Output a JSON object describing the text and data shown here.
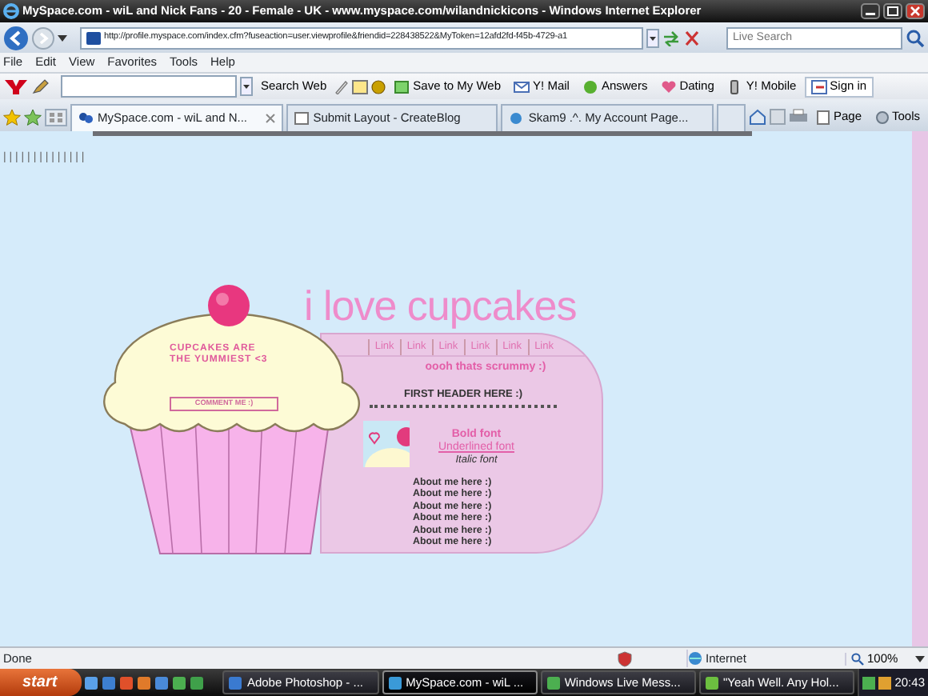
{
  "window": {
    "title": "MySpace.com - wiL and Nick Fans - 20 - Female - UK - www.myspace.com/wilandnickicons - Windows Internet Explorer"
  },
  "address_bar": {
    "url": "http://profile.myspace.com/index.cfm?fuseaction=user.viewprofile&friendid=228438522&MyToken=12afd2fd-f45b-4729-a1",
    "search_placeholder": "Live Search"
  },
  "menu": [
    "File",
    "Edit",
    "View",
    "Favorites",
    "Tools",
    "Help"
  ],
  "yahoo_toolbar": {
    "search_button": "Search Web",
    "items": [
      {
        "kind": "web",
        "label": "Save to My Web"
      },
      {
        "kind": "mail",
        "label": "Y! Mail"
      },
      {
        "kind": "answers",
        "label": "Answers"
      },
      {
        "kind": "dating",
        "label": "Dating"
      },
      {
        "kind": "mobile",
        "label": "Y! Mobile"
      },
      {
        "kind": "signin",
        "label": "Sign in"
      }
    ]
  },
  "tabs": [
    {
      "label": "MySpace.com - wiL and N...",
      "selected": true
    },
    {
      "label": "Submit Layout - CreateBlog",
      "selected": false
    },
    {
      "label": "Skam9 .^. My Account Page...",
      "selected": false
    }
  ],
  "command_bar": [
    "Page",
    "Tools"
  ],
  "page": {
    "ticks": "| | | | | | | | | | | | | |",
    "cupcake": {
      "tagline": [
        "CUPCAKES ARE",
        "THE YUMMIEST <3"
      ],
      "button": "COMMENT ME :)"
    },
    "title": "i love cupcakes",
    "links": [
      "Link",
      "Link",
      "Link",
      "Link",
      "Link",
      "Link"
    ],
    "subtitle": "oooh thats scrummy :)",
    "header": "FIRST HEADER HERE :)",
    "font_samples": [
      {
        "kind": "bold",
        "text": "Bold font"
      },
      {
        "kind": "underline",
        "text": "Underlined font"
      },
      {
        "kind": "italic",
        "text": "Italic font"
      }
    ],
    "about": [
      "About me here :)",
      "About me here :)",
      "About me here :)",
      "About me here :)",
      "About me here :)",
      "About me here :)"
    ]
  },
  "status_bar": {
    "text": "Done",
    "zone": "Internet",
    "zoom": "100%"
  },
  "taskbar": {
    "start": "start",
    "tasks": [
      {
        "label": "Adobe Photoshop - ...",
        "selected": false
      },
      {
        "label": "MySpace.com - wiL ...",
        "selected": true
      },
      {
        "label": "Windows Live Mess...",
        "selected": false
      },
      {
        "label": "\"Yeah Well. Any Hol...",
        "selected": false
      }
    ],
    "clock": "20:43"
  }
}
